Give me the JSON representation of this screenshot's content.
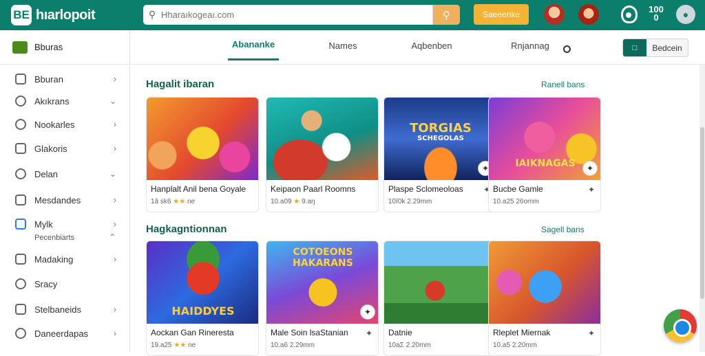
{
  "app": {
    "logo_mark": "BE",
    "name": "hıarlopoit"
  },
  "search": {
    "placeholder": "Hharaıkogeaı.com"
  },
  "header": {
    "cta_label": "Saeeenke",
    "stat_value": "100",
    "stat_sub": "0"
  },
  "sidebar": {
    "header": "Bburas",
    "items": [
      {
        "label": "Bburan",
        "icon": "book-icon"
      },
      {
        "label": "Akıkrans",
        "icon": "heart-icon"
      },
      {
        "label": "Nookarles",
        "icon": "heart-icon"
      },
      {
        "label": "Glakoris",
        "icon": "chart-icon"
      },
      {
        "label": "Delan",
        "icon": "globe-icon"
      },
      {
        "label": "Mesdandes",
        "icon": "camera-icon"
      },
      {
        "label": "Mylk",
        "icon": "app-icon",
        "sub": "Pecenbiarts"
      },
      {
        "label": "Madaking",
        "icon": "briefcase-icon"
      },
      {
        "label": "Sracy",
        "icon": "search-icon"
      },
      {
        "label": "Stelbaneids",
        "icon": "x-icon"
      },
      {
        "label": "Daneerdapas",
        "icon": "gear-icon"
      }
    ]
  },
  "tabs": [
    {
      "label": "Abananke"
    },
    {
      "label": "Names"
    },
    {
      "label": "Aqbenben"
    },
    {
      "label": "Rnjannag"
    }
  ],
  "view_toggle": {
    "icon_label": "□",
    "label": "Bedcein"
  },
  "sections": [
    {
      "title": "Hagalit ibaran",
      "link": "Ranell bans",
      "cards": [
        {
          "title": "Hanplalt Anil bena Goyale",
          "meta": "1â sk6",
          "stars": "★★",
          "meta2": "ne",
          "art": "puzzle"
        },
        {
          "title": "Keipaon Paarl Roomns",
          "meta": "10.a09",
          "stars": "★",
          "meta2": "9.aŋ",
          "art": "arcade"
        },
        {
          "title": "Plaspe Sclomeoloas",
          "meta": "10î0k",
          "stars": "",
          "meta2": "2.29mm",
          "art": "runner",
          "overlay": "TORGIAS\nSCHEGOLAS"
        },
        {
          "title": "Bucbe Gamle",
          "meta": "10.a25",
          "stars": "",
          "meta2": "26omm",
          "art": "hero",
          "overlay": "IAIKNAGAS"
        }
      ]
    },
    {
      "title": "Hagkagntionnan",
      "link": "Sagell bans",
      "cards": [
        {
          "title": "Aockan Gan Rineresta",
          "meta": "19.a25",
          "stars": "★★",
          "meta2": "ne",
          "art": "hero2",
          "overlay": "HAIDDYES"
        },
        {
          "title": "Male Soin lsaStanian",
          "meta": "10.a6",
          "stars": "",
          "meta2": "2.29mm",
          "art": "rocket",
          "overlay": "COTOEONS\nHAKARANS"
        },
        {
          "title": "Datnie",
          "meta": "10aΣ",
          "stars": "",
          "meta2": "2.20mm",
          "art": "field"
        },
        {
          "title": "Rleplet Miernak",
          "meta": "10.a5",
          "stars": "",
          "meta2": "2.20mm",
          "art": "monster"
        }
      ]
    }
  ],
  "colors": {
    "primary": "#0c7f6c",
    "accent": "#f5b335",
    "star": "#f2a60c"
  }
}
